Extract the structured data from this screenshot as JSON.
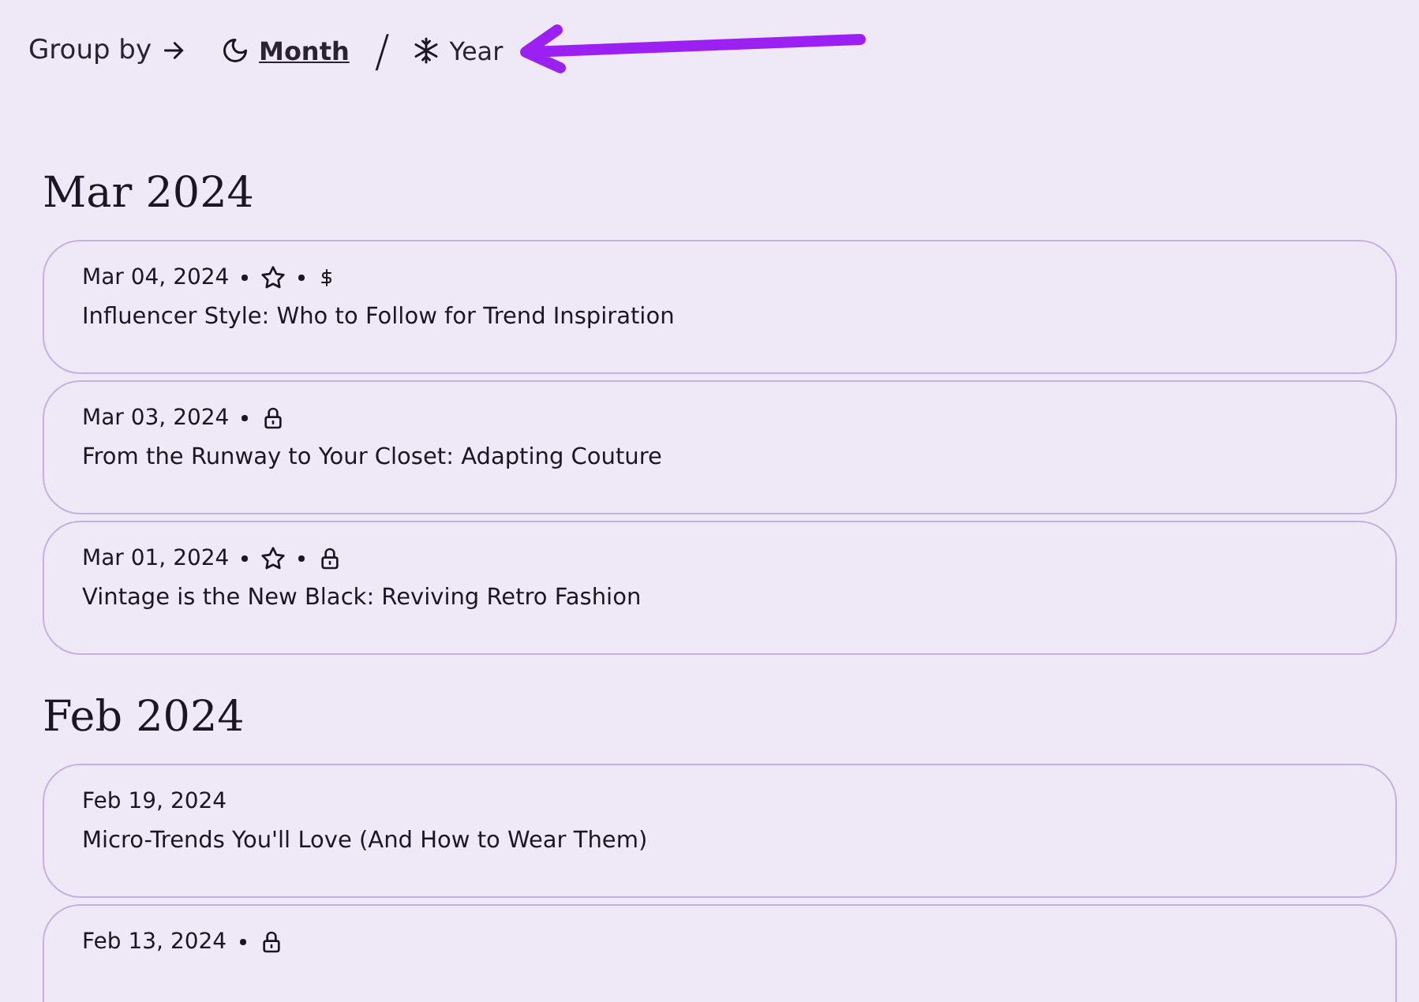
{
  "group_by": {
    "label": "Group by",
    "separator": "/",
    "options": [
      {
        "label": "Month",
        "kind": "moon",
        "selected": true
      },
      {
        "label": "Year",
        "kind": "snowflake",
        "selected": false
      }
    ]
  },
  "groups": [
    {
      "heading": "Mar 2024",
      "posts": [
        {
          "date": "Mar 04, 2024",
          "badges": [
            {
              "kind": "star"
            },
            {
              "kind": "paid"
            }
          ],
          "title": "Influencer Style: Who to Follow for Trend Inspiration"
        },
        {
          "date": "Mar 03, 2024",
          "badges": [
            {
              "kind": "locked"
            }
          ],
          "title": "From the Runway to Your Closet: Adapting Couture"
        },
        {
          "date": "Mar 01, 2024",
          "badges": [
            {
              "kind": "star"
            },
            {
              "kind": "locked"
            }
          ],
          "title": "Vintage is the New Black: Reviving Retro Fashion"
        }
      ]
    },
    {
      "heading": "Feb 2024",
      "posts": [
        {
          "date": "Feb 19, 2024",
          "title": "Micro-Trends You'll Love (And How to Wear Them)"
        },
        {
          "date": "Feb 13, 2024",
          "badges": [
            {
              "kind": "locked"
            }
          ]
        }
      ]
    }
  ]
}
